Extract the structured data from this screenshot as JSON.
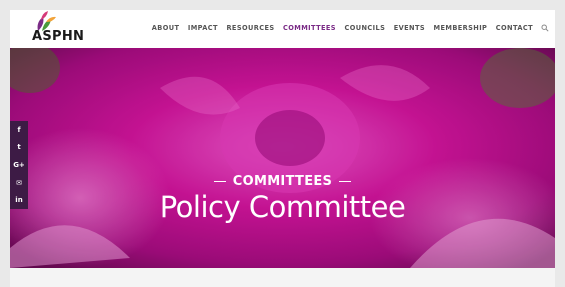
{
  "brand": {
    "name": "ASPHN",
    "logo_icon": "leaves-logo-icon"
  },
  "nav": {
    "items": [
      {
        "label": "ABOUT",
        "active": false
      },
      {
        "label": "IMPACT",
        "active": false
      },
      {
        "label": "RESOURCES",
        "active": false
      },
      {
        "label": "COMMITTEES",
        "active": true
      },
      {
        "label": "COUNCILS",
        "active": false
      },
      {
        "label": "EVENTS",
        "active": false
      },
      {
        "label": "MEMBERSHIP",
        "active": false
      },
      {
        "label": "CONTACT",
        "active": false
      }
    ],
    "search_icon": "search-icon"
  },
  "social": [
    {
      "label": "f",
      "icon": "facebook-icon"
    },
    {
      "label": "t",
      "icon": "twitter-icon"
    },
    {
      "label": "G+",
      "icon": "google-plus-icon"
    },
    {
      "label": "✉",
      "icon": "email-icon"
    },
    {
      "label": "in",
      "icon": "linkedin-icon"
    }
  ],
  "hero": {
    "kicker": "COMMITTEES",
    "title": "Policy Committee"
  },
  "colors": {
    "accent": "#7a2b86",
    "social_bg": "#3d1b45",
    "hero": "#d4149e"
  }
}
